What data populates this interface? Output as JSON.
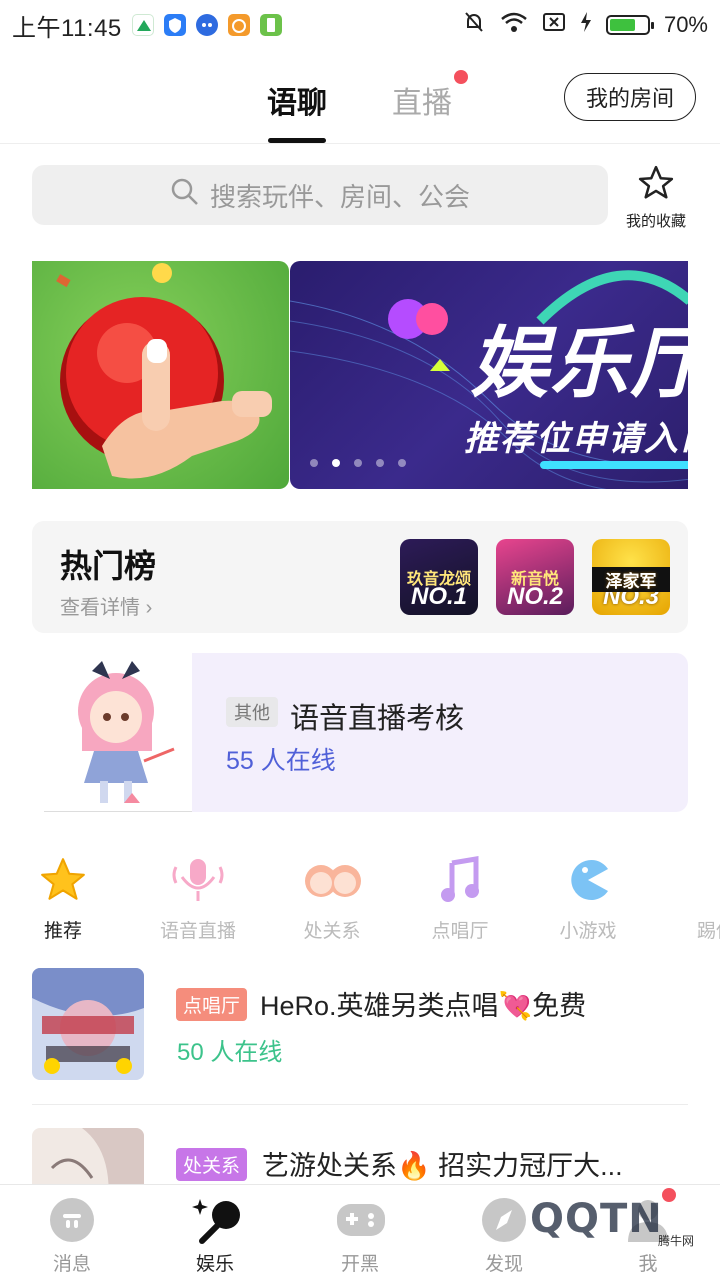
{
  "status_bar": {
    "time": "上午11:45",
    "battery": "70%",
    "battery_level": 0.7
  },
  "top_nav": {
    "tabs": [
      {
        "label": "语聊",
        "active": true
      },
      {
        "label": "直播",
        "has_dot": true
      }
    ],
    "my_room_button": "我的房间"
  },
  "search": {
    "placeholder": "搜索玩伴、房间、公会",
    "favorites_label": "我的收藏"
  },
  "banner": {
    "title": "娱乐厅",
    "subtitle": "推荐位申请入口",
    "page_count": 5,
    "active_index": 1
  },
  "hot_list": {
    "title": "热门榜",
    "more": "查看详情",
    "ranks": [
      {
        "label": "NO.1",
        "top_text": "玖音龙颂"
      },
      {
        "label": "NO.2",
        "top_text": "新音悦"
      },
      {
        "label": "NO.3",
        "top_text": "泽家军"
      }
    ]
  },
  "featured_room": {
    "tag": "其他",
    "title": "语音直播考核",
    "online": "55 人在线"
  },
  "categories": [
    {
      "label": "推荐",
      "icon": "star-icon",
      "active": true
    },
    {
      "label": "语音直播",
      "icon": "microphone-icon"
    },
    {
      "label": "处关系",
      "icon": "couple-icon"
    },
    {
      "label": "点唱厅",
      "icon": "music-note-icon"
    },
    {
      "label": "小游戏",
      "icon": "pacman-icon"
    },
    {
      "label": "踢保",
      "icon": "ball-icon"
    }
  ],
  "rooms": [
    {
      "tag": "点唱厅",
      "tag_color": "#f58d7c",
      "title": "HeRo.英雄另类点唱💘免费",
      "online": "50 人在线"
    },
    {
      "tag": "处关系",
      "tag_color": "#c776e8",
      "title": "艺游处关系🔥 招实力冠厅大...",
      "online": ""
    }
  ],
  "bottom_nav": [
    {
      "label": "消息",
      "icon": "message-icon"
    },
    {
      "label": "娱乐",
      "icon": "sparkle-mic-icon",
      "active": true
    },
    {
      "label": "开黑",
      "icon": "gamepad-icon"
    },
    {
      "label": "发现",
      "icon": "compass-icon"
    },
    {
      "label": "我",
      "icon": "profile-icon",
      "has_dot": true
    }
  ],
  "watermark": {
    "text": "QQTN",
    "small": "腾牛网"
  }
}
